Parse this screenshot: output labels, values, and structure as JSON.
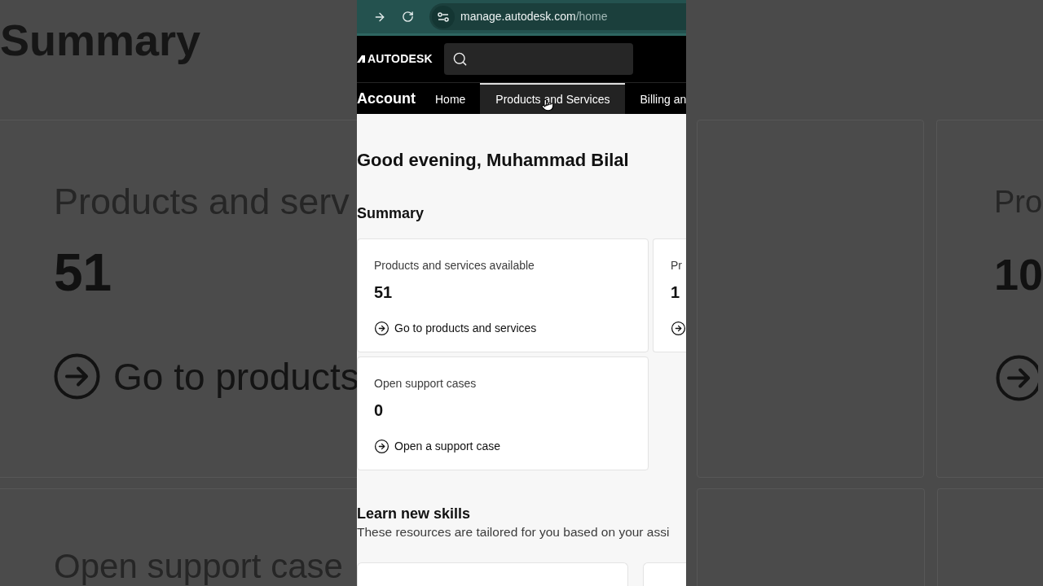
{
  "backdrop_left": {
    "heading": "Summary",
    "card": {
      "label": "Products and serv",
      "value": "51",
      "link": "Go to products"
    },
    "next_card": {
      "label": "Open support case"
    }
  },
  "browser": {
    "address": {
      "host": "manage.autodesk.com",
      "path": "/home"
    }
  },
  "header": {
    "logo": "AUTODESK"
  },
  "nav": {
    "title": "Account",
    "tabs": [
      {
        "label": "Home",
        "selected": false
      },
      {
        "label": "Products and Services",
        "selected": true
      },
      {
        "label": "Billing an",
        "selected": false
      }
    ]
  },
  "page": {
    "greeting": "Good evening, Muhammad Bilal",
    "summary": {
      "title": "Summary",
      "cards": [
        {
          "label": "Products and services available",
          "value": "51",
          "link": "Go to products and services"
        },
        {
          "label": "Pr",
          "value": "1"
        },
        {
          "label": "Open support cases",
          "value": "0",
          "link": "Open a support case"
        }
      ]
    },
    "learn": {
      "title": "Learn new skills",
      "description": "These resources are tailored for you based on your assi"
    }
  },
  "backdrop_right": {
    "card": {
      "label": "Pro",
      "value": "10"
    }
  }
}
